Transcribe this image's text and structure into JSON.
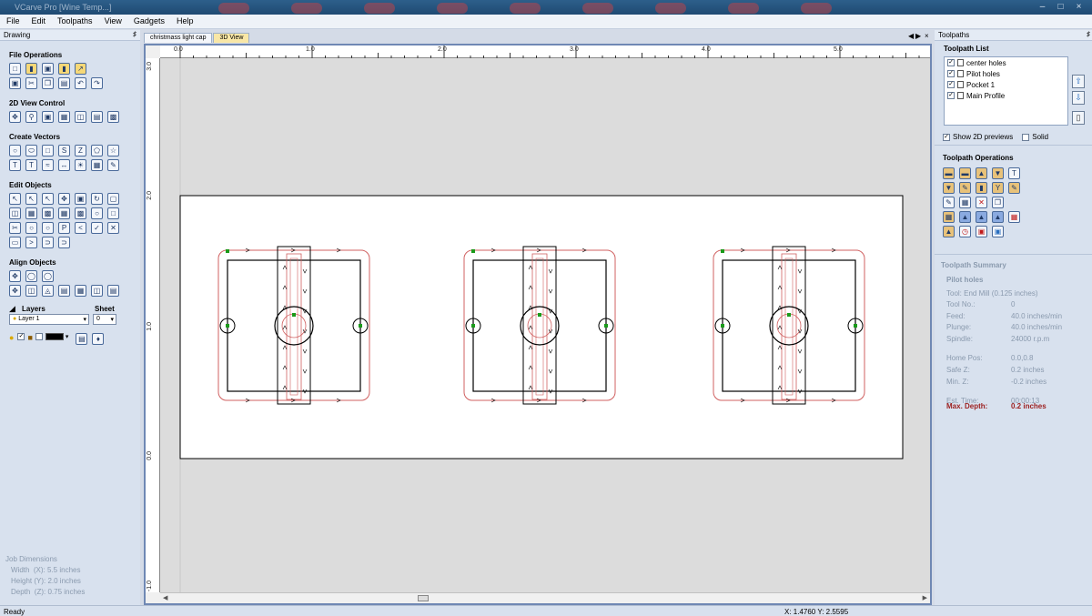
{
  "window": {
    "title": "VCarve Pro [Wine Temp...]"
  },
  "menu": [
    "File",
    "Edit",
    "Toolpaths",
    "View",
    "Gadgets",
    "Help"
  ],
  "left_panel": {
    "title": "Drawing",
    "sections": {
      "file_ops": "File Operations",
      "view2d": "2D View Control",
      "create_vectors": "Create Vectors",
      "edit_objects": "Edit Objects",
      "align_objects": "Align Objects"
    },
    "layers_label": "Layers",
    "sheet_label": "Sheet",
    "layer_value": "Layer 1",
    "sheet_value": "0",
    "job": {
      "title": "Job Dimensions",
      "width": "Width  (X): 5.5 inches",
      "height": "Height (Y): 2.0 inches",
      "depth": "Depth  (Z): 0.75 inches"
    }
  },
  "tabs": [
    "christmass light cap",
    "3D View"
  ],
  "ruler": {
    "x_labels": [
      "0.0",
      "1.0",
      "2.0",
      "3.0",
      "4.0",
      "5.0"
    ],
    "y_labels": [
      "3.0",
      "2.0",
      "1.0",
      "0.0",
      "-1.0"
    ]
  },
  "status": {
    "left": "Ready",
    "coords": "X: 1.4760 Y: 2.5595"
  },
  "right_panel": {
    "title": "Toolpaths",
    "list_title": "Toolpath List",
    "items": [
      "center holes",
      "Pilot holes",
      "Pocket 1",
      "Main Profile"
    ],
    "show2d": "Show 2D previews",
    "solid": "Solid",
    "ops_title": "Toolpath Operations",
    "summary_title": "Toolpath Summary",
    "summary_name": "Pilot holes",
    "tool": "Tool: End Mill (0.125 inches)",
    "rows": [
      {
        "label": "Tool No.:",
        "value": "0"
      },
      {
        "label": "Feed:",
        "value": "40.0 inches/min"
      },
      {
        "label": "Plunge:",
        "value": "40.0 inches/min"
      },
      {
        "label": "Spindle:",
        "value": "24000 r.p.m"
      },
      {
        "label": "Home Pos:",
        "value": "0.0,0.8"
      },
      {
        "label": "Safe Z:",
        "value": "0.2 inches"
      },
      {
        "label": "Min. Z:",
        "value": "-0.2 inches"
      },
      {
        "label": "Est. Time:",
        "value": "00:00:13"
      }
    ],
    "max_depth_label": "Max. Depth:",
    "max_depth_value": "0.2 inches"
  },
  "colors": {
    "accent": "#6f88b4",
    "toolpath": "#d06060",
    "vector": "#000000",
    "marker": "#1a9a1a"
  }
}
